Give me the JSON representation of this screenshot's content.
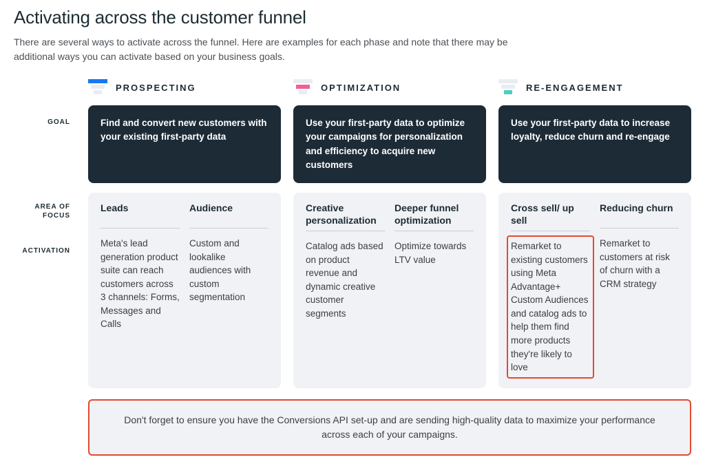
{
  "title": "Activating across the customer funnel",
  "intro": "There are several ways to activate across the funnel. Here are examples for each phase and note that there may be additional ways you can activate based on your business goals.",
  "row_labels": {
    "goal": "GOAL",
    "area": "AREA OF FOCUS",
    "activation": "ACTIVATION"
  },
  "stages": [
    {
      "name": "PROSPECTING",
      "accent": "#1877f2",
      "goal": "Find and convert new customers with your existing first-party data",
      "focus": [
        {
          "title": "Leads",
          "body": "Meta's lead generation product suite can reach customers across 3 channels: Forms, Messages and Calls"
        },
        {
          "title": "Audience",
          "body": "Custom and lookalike audiences with custom segmentation"
        }
      ]
    },
    {
      "name": "OPTIMIZATION",
      "accent": "#f06292",
      "goal": "Use your first-party data to optimize your campaigns for personalization and efficiency to acquire new customers",
      "focus": [
        {
          "title": "Creative personalization",
          "body": "Catalog ads based on product revenue and dynamic creative customer segments"
        },
        {
          "title": "Deeper funnel optimization",
          "body": "Optimize towards LTV value"
        }
      ]
    },
    {
      "name": "RE-ENGAGEMENT",
      "accent": "#4ecdc4",
      "goal": "Use your first-party data to increase loyalty, reduce churn and re-engage",
      "focus": [
        {
          "title": "Cross sell/ up sell",
          "body": "Remarket to existing customers using Meta Advantage+ Custom Audiences and catalog ads to help them find more products they're likely to love",
          "highlight": true
        },
        {
          "title": "Reducing churn",
          "body": "Remarket to customers at risk of churn with a CRM strategy"
        }
      ]
    }
  ],
  "footnote": "Don't forget to ensure you have the Conversions API set-up and are sending high-quality data to maximize your performance across each of your campaigns."
}
